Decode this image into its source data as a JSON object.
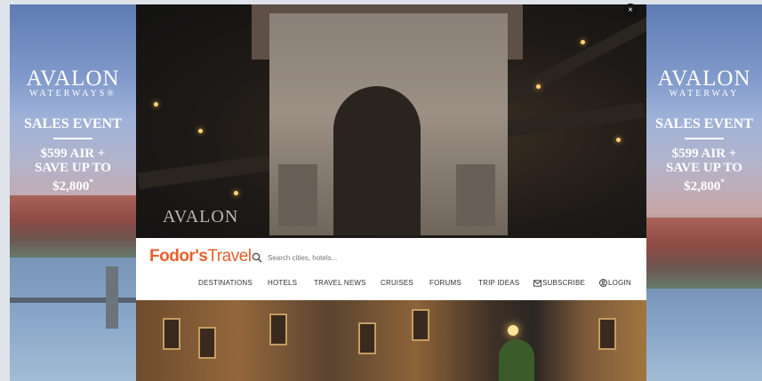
{
  "left_ad": {
    "brand_name": "AVALON",
    "brand_sub": "WATERWAYS",
    "trademark": "®",
    "event": "SALES EVENT",
    "offer_line1": "$599 AIR +",
    "offer_line2": "SAVE UP TO",
    "offer_line3": "$2,800",
    "offer_mark": "*"
  },
  "right_ad": {
    "brand_name": "AVALON",
    "brand_sub": "WATERWAY",
    "event": "SALES EVENT",
    "offer_line1": "$599 AIR +",
    "offer_line2": "SAVE UP TO",
    "offer_line3": "$2,800",
    "offer_mark": "*"
  },
  "hero": {
    "logo_text": "AVALON",
    "close_label": "×"
  },
  "site": {
    "brand_bold": "Fodor's",
    "brand_light": "Travel",
    "search_placeholder": "Search cities, hotels...",
    "brand_color": "#e8602c",
    "nav": {
      "destinations": "DESTINATIONS",
      "hotels": "HOTELS",
      "travel_news": "TRAVEL NEWS",
      "cruises": "CRUISES",
      "forums": "FORUMS",
      "trip_ideas": "TRIP IDEAS",
      "subscribe": "SUBSCRIBE",
      "login": "LOGIN"
    }
  }
}
